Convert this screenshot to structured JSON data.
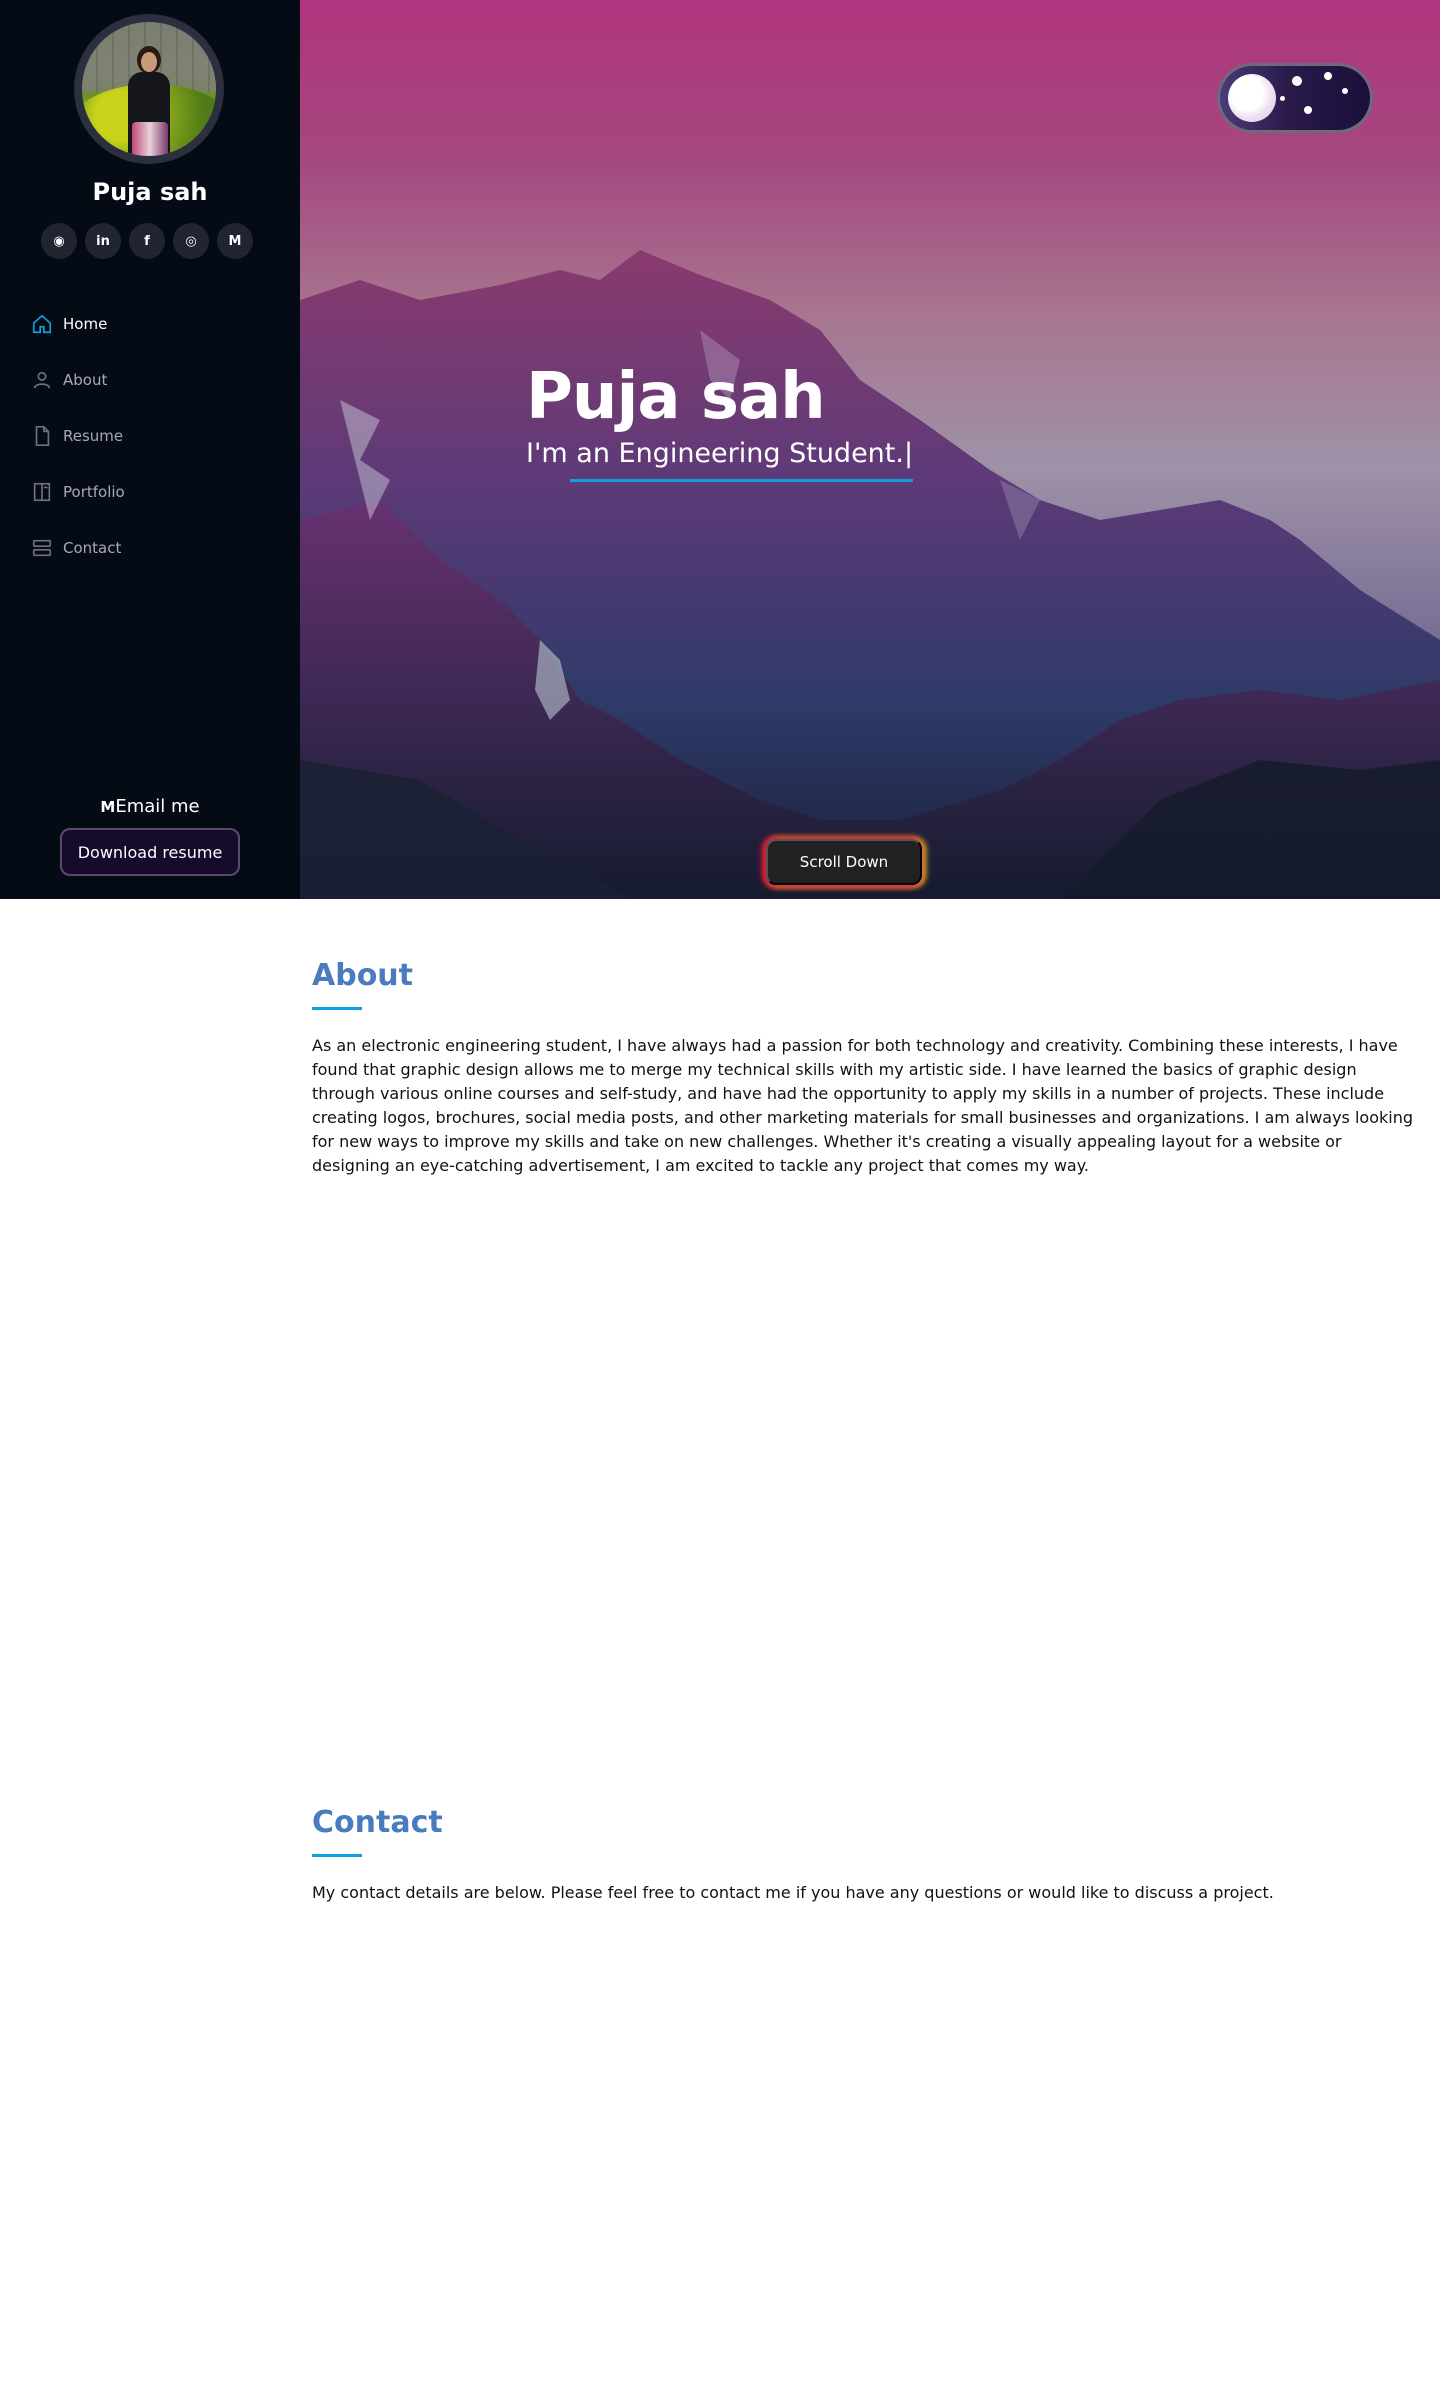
{
  "profile": {
    "name": "Puja sah",
    "avatar_alt": "Profile photo"
  },
  "socials": [
    {
      "icon": "github-icon",
      "glyph": "◉"
    },
    {
      "icon": "linkedin-icon",
      "glyph": "in"
    },
    {
      "icon": "facebook-icon",
      "glyph": "f"
    },
    {
      "icon": "instagram-icon",
      "glyph": "◎"
    },
    {
      "icon": "gmail-icon",
      "glyph": "M"
    }
  ],
  "nav": {
    "items": [
      {
        "label": "Home",
        "icon": "home-icon",
        "active": true
      },
      {
        "label": "About",
        "icon": "user-icon",
        "active": false
      },
      {
        "label": "Resume",
        "icon": "file-icon",
        "active": false
      },
      {
        "label": "Portfolio",
        "icon": "book-icon",
        "active": false
      },
      {
        "label": "Contact",
        "icon": "server-icon",
        "active": false
      }
    ]
  },
  "sidebar_footer": {
    "email_icon": "M",
    "email_label": "Email me",
    "download_label": "Download resume"
  },
  "hero": {
    "title": "Puja sah",
    "subtitle": "I'm an Engineering Student.|",
    "scroll_label": "Scroll Down",
    "theme_toggle": "dark-mode"
  },
  "about": {
    "title": "About",
    "text": "As an electronic engineering student, I have always had a passion for both technology and creativity. Combining these interests, I have found that graphic design allows me to merge my technical skills with my artistic side. I have learned the basics of graphic design through various online courses and self-study, and have had the opportunity to apply my skills in a number of projects. These include creating logos, brochures, social media posts, and other marketing materials for small businesses and organizations. I am always looking for new ways to improve my skills and take on new challenges. Whether it's creating a visually appealing layout for a website or designing an eye-catching advertisement, I am excited to tackle any project that comes my way."
  },
  "contact": {
    "title": "Contact",
    "text": "My contact details are below. Please feel free to contact me if you have any questions or would like to discuss a project."
  },
  "colors": {
    "sidebar_bg": "#040b14",
    "accent": "#149ddd",
    "section_title": "#4a7bbf"
  }
}
